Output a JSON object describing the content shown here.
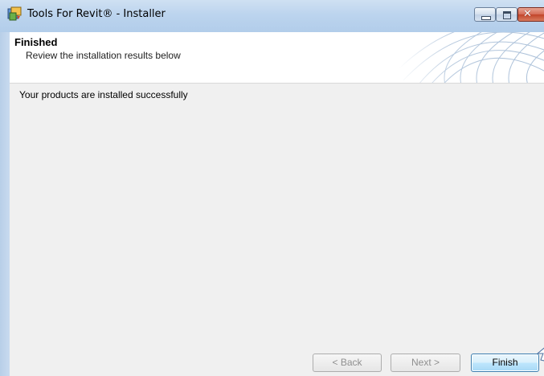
{
  "window": {
    "title": "Tools For Revit® - Installer"
  },
  "header": {
    "title": "Finished",
    "subtitle": "Review the installation results below"
  },
  "content": {
    "status": "Your products are installed successfully"
  },
  "buttons": {
    "back": "< Back",
    "next": "Next >",
    "finish": "Finish",
    "back_enabled": false,
    "next_enabled": false
  },
  "icons": {
    "app": "installer-app-icon",
    "minimize": "minimize-icon",
    "maximize": "maximize-icon",
    "close": "close-icon",
    "header_art": "globe-mesh-graphic",
    "cursor": "mouse-cursor-icon"
  },
  "colors": {
    "titlebar": "#bcd4ee",
    "close_button": "#c2452a",
    "finish_button_border": "#3c7fb1",
    "dialog_background": "#f0f0f0"
  }
}
